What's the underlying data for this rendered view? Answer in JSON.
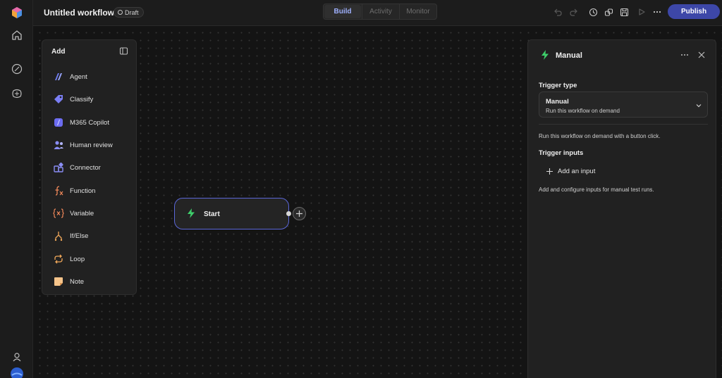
{
  "header": {
    "title": "Untitled workflow",
    "status_badge": "Draft",
    "tabs": [
      {
        "label": "Build",
        "active": true
      },
      {
        "label": "Activity",
        "active": false
      },
      {
        "label": "Monitor",
        "active": false
      }
    ],
    "toolbar_icons": [
      "undo-icon",
      "redo-icon",
      "history-icon",
      "share-icon",
      "save-icon",
      "play-icon",
      "more-icon"
    ],
    "publish_label": "Publish"
  },
  "rail": {
    "icons": [
      "app-logo-icon",
      "home-icon",
      "workflows-icon",
      "agents-icon",
      "user-icon",
      "avatar"
    ]
  },
  "add_panel": {
    "title": "Add",
    "items": [
      {
        "label": "Agent",
        "icon": "agent-icon"
      },
      {
        "label": "Classify",
        "icon": "classify-icon"
      },
      {
        "label": "M365 Copilot",
        "icon": "copilot-icon"
      },
      {
        "label": "Human review",
        "icon": "human-review-icon"
      },
      {
        "label": "Connector",
        "icon": "connector-icon"
      },
      {
        "label": "Function",
        "icon": "function-icon"
      },
      {
        "label": "Variable",
        "icon": "variable-icon"
      },
      {
        "label": "If/Else",
        "icon": "branch-icon"
      },
      {
        "label": "Loop",
        "icon": "loop-icon"
      },
      {
        "label": "Note",
        "icon": "note-icon"
      }
    ]
  },
  "canvas": {
    "start_node": {
      "label": "Start",
      "icon": "lightning-icon"
    }
  },
  "properties_panel": {
    "title": "Manual",
    "trigger_type_label": "Trigger type",
    "trigger_type_value": "Manual",
    "trigger_type_description": "Run this workflow on demand",
    "info_text": "Run this workflow on demand with a button click.",
    "trigger_inputs_label": "Trigger inputs",
    "add_input_label": "Add an input",
    "inputs_help_text": "Add and configure inputs for manual test runs."
  },
  "colors": {
    "accent": "#5b67d8",
    "publish": "#3d47a8",
    "trigger_green": "#3ecf6a"
  }
}
